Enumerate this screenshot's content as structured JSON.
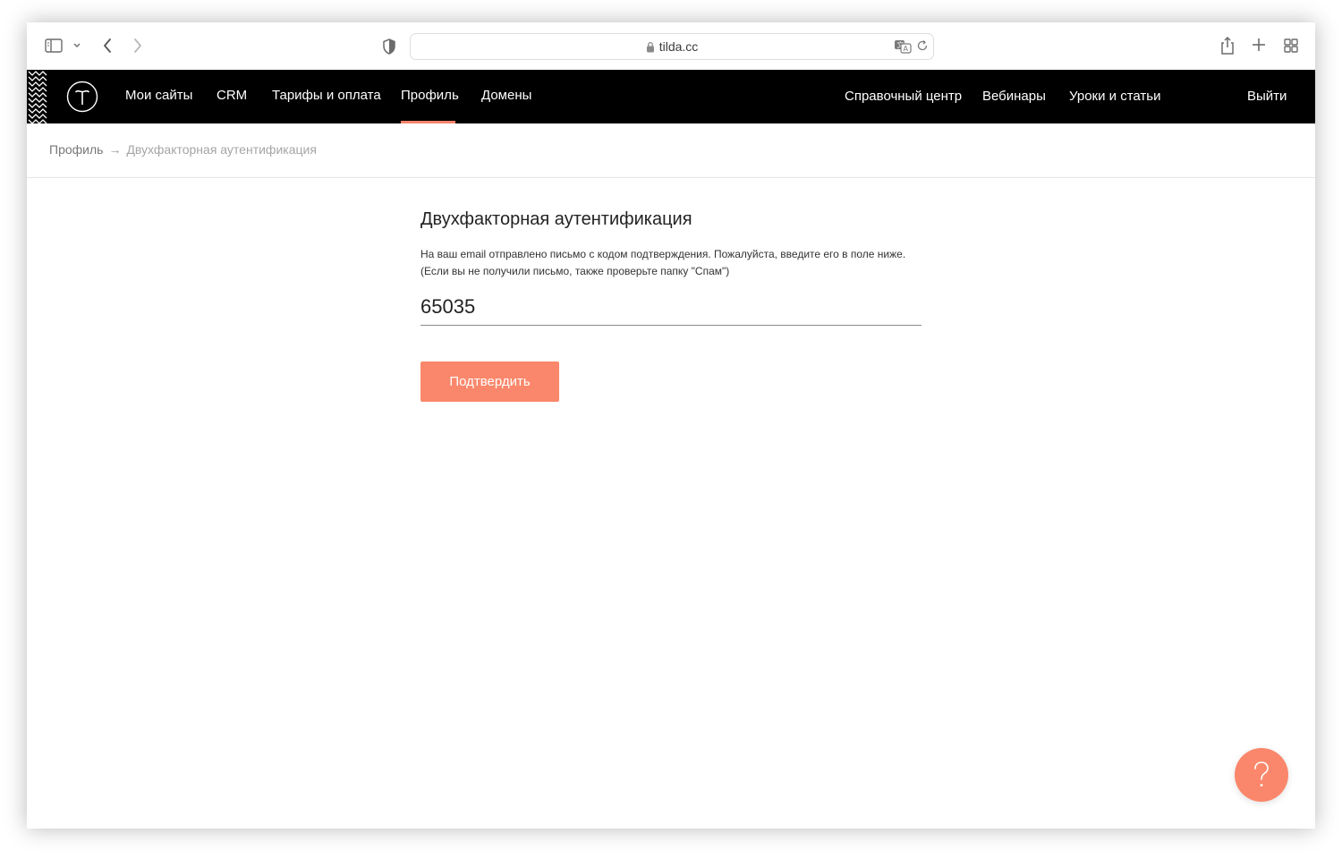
{
  "browser": {
    "url": "tilda.cc",
    "icons": {
      "sidebar": "sidebar-icon",
      "back": "chevron-left-icon",
      "forward": "chevron-right-icon",
      "privacy": "shield-icon",
      "lock": "lock-icon",
      "translate": "translate-icon",
      "reload": "reload-icon",
      "share": "share-icon",
      "new_tab": "plus-icon",
      "tabs": "tab-overview-icon"
    }
  },
  "header": {
    "nav_left": [
      "Мои сайты",
      "CRM",
      "Тарифы и оплата",
      "Профиль",
      "Домены"
    ],
    "active": "Профиль",
    "nav_right": [
      "Справочный центр",
      "Вебинары",
      "Уроки и статьи"
    ],
    "logout": "Выйти"
  },
  "breadcrumb": {
    "parent": "Профиль",
    "separator": "→",
    "current": "Двухфакторная аутентификация"
  },
  "form": {
    "title": "Двухфакторная аутентификация",
    "description_line1": "На ваш email отправлено письмо с кодом подтверждения. Пожалуйста, введите его в поле ниже.",
    "description_line2": "(Если вы не получили письмо, также проверьте папку \"Спам\")",
    "code_value": "65035",
    "submit_label": "Подтвердить"
  },
  "help": {
    "symbol": "?"
  },
  "colors": {
    "accent": "#fa876b",
    "header_bg": "#000000"
  }
}
